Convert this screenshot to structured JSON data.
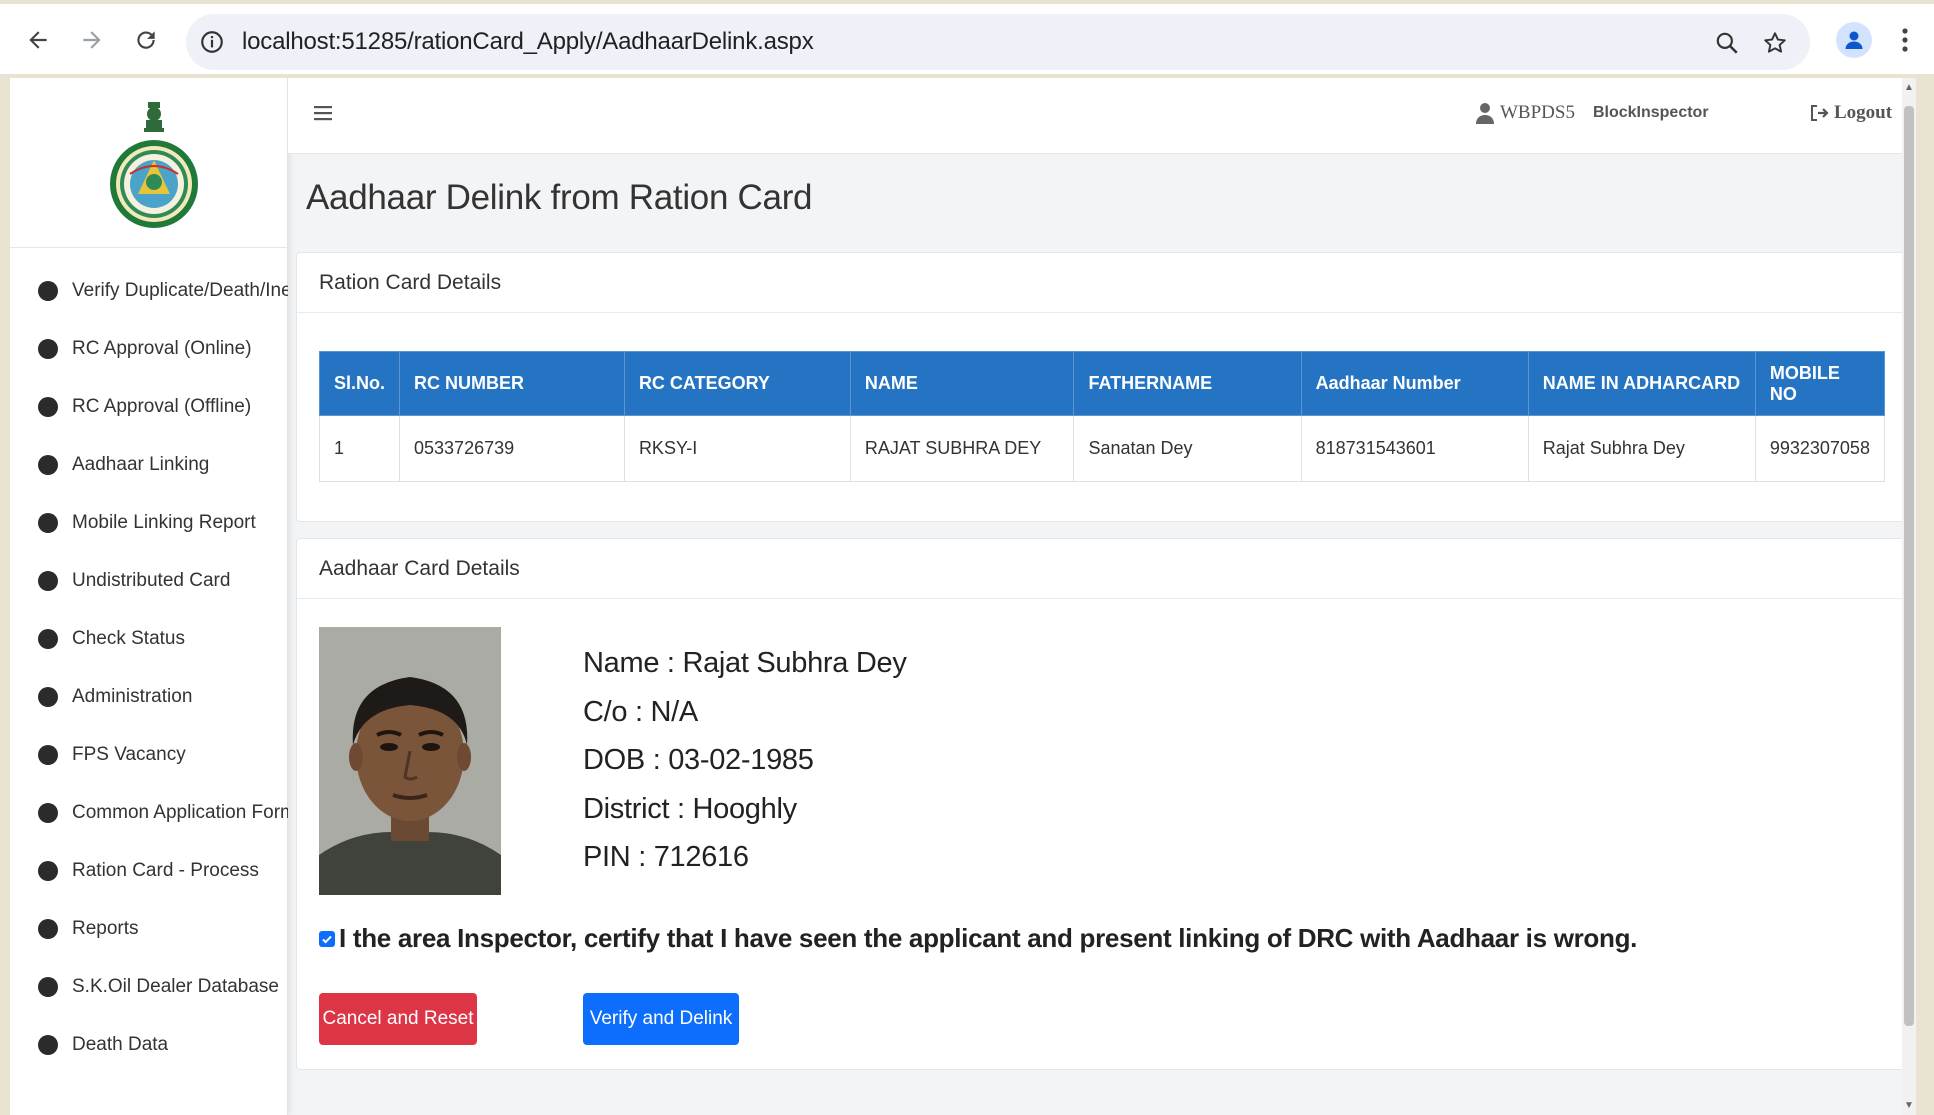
{
  "browser": {
    "url": "localhost:51285/rationCard_Apply/AadhaarDelink.aspx"
  },
  "colors": {
    "table_header": "#2574c3",
    "cancel_button": "#dc3545",
    "verify_button": "#0d6efd"
  },
  "sidebar": {
    "items": [
      {
        "label": "Verify Duplicate/Death/Inelig"
      },
      {
        "label": "RC Approval (Online)"
      },
      {
        "label": "RC Approval (Offline)"
      },
      {
        "label": "Aadhaar Linking"
      },
      {
        "label": "Mobile Linking Report"
      },
      {
        "label": "Undistributed Card"
      },
      {
        "label": "Check Status"
      },
      {
        "label": "Administration"
      },
      {
        "label": "FPS Vacancy"
      },
      {
        "label": "Common Application Form"
      },
      {
        "label": "Ration Card - Process"
      },
      {
        "label": "Reports"
      },
      {
        "label": "S.K.Oil Dealer Database"
      },
      {
        "label": "Death Data"
      }
    ]
  },
  "header": {
    "user_name": "WBPDS5",
    "user_role": "BlockInspector",
    "logout_label": "Logout"
  },
  "page": {
    "title": "Aadhaar Delink from Ration Card"
  },
  "ration_card": {
    "section_title": "Ration Card Details",
    "columns": [
      "Sl.No.",
      "RC NUMBER",
      "RC CATEGORY",
      "NAME",
      "FATHERNAME",
      "Aadhaar Number",
      "NAME IN ADHARCARD",
      "MOBILE NO"
    ],
    "rows": [
      [
        "1",
        "0533726739",
        "RKSY-I",
        "RAJAT SUBHRA DEY",
        "Sanatan Dey",
        "818731543601",
        "Rajat Subhra Dey",
        "9932307058"
      ]
    ]
  },
  "aadhaar_card": {
    "section_title": "Aadhaar Card Details",
    "details": [
      {
        "key": "Name : ",
        "value": "Rajat Subhra Dey"
      },
      {
        "key": "C/o : ",
        "value": "N/A"
      },
      {
        "key": "DOB : ",
        "value": "03-02-1985"
      },
      {
        "key": "District : ",
        "value": "Hooghly"
      },
      {
        "key": "PIN : ",
        "value": "712616"
      }
    ],
    "certification_text": "I the area Inspector, certify that I have seen the applicant and present linking of DRC with Aadhaar is wrong.",
    "certification_checked": true,
    "cancel_label": "Cancel and Reset",
    "verify_label": "Verify and Delink"
  }
}
